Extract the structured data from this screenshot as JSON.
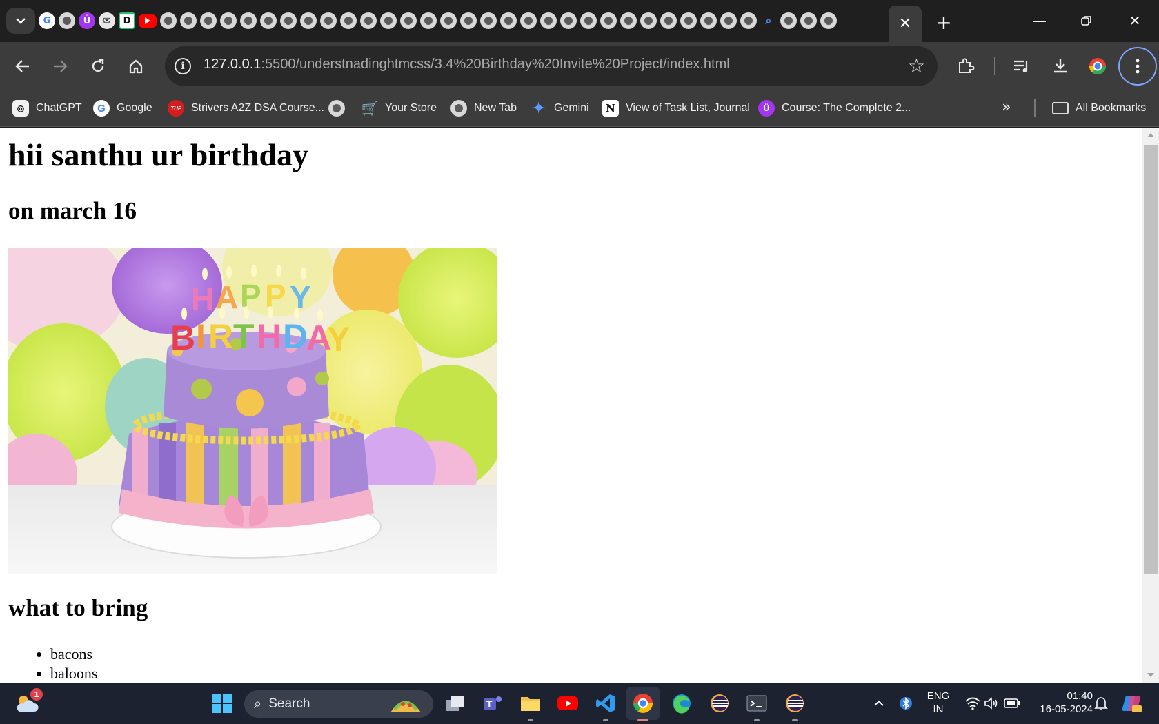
{
  "browser": {
    "url_host": "127.0.0.1",
    "url_path": ":5500/understnadinghtmcss/3.4%20Birthday%20Invite%20Project/index.html",
    "tabs": {
      "favicons": [
        "google",
        "globe",
        "udemy",
        "mail",
        "d-icon",
        "youtube",
        "globe",
        "globe",
        "globe",
        "globe",
        "globe",
        "globe",
        "globe",
        "globe",
        "globe",
        "globe",
        "globe",
        "globe",
        "globe",
        "globe",
        "globe",
        "globe",
        "globe",
        "globe",
        "globe",
        "globe",
        "globe",
        "globe",
        "globe",
        "globe",
        "globe",
        "globe",
        "globe",
        "globe",
        "globe",
        "globe",
        "lens",
        "globe",
        "globe",
        "globe"
      ]
    }
  },
  "bookmarks": [
    {
      "icon": "chatgpt-icon",
      "label": "ChatGPT"
    },
    {
      "icon": "google-icon",
      "label": "Google"
    },
    {
      "icon": "tuf-icon",
      "label": "Strivers A2Z DSA Course..."
    },
    {
      "icon": "globe-icon",
      "label": ""
    },
    {
      "icon": "cart-icon",
      "label": "Your Store"
    },
    {
      "icon": "globe-icon",
      "label": "New Tab"
    },
    {
      "icon": "gemini-icon",
      "label": "Gemini"
    },
    {
      "icon": "notion-icon",
      "label": "View of Task List, Journal"
    },
    {
      "icon": "udemy-icon",
      "label": "Course: The Complete 2..."
    }
  ],
  "bookmarks_all": "All Bookmarks",
  "page": {
    "heading": "hii santhu ur birthday",
    "date": "on march 16",
    "image_alt": "HAPPY BIRTHDAY",
    "bring_heading": "what to bring",
    "bring_items": [
      "bacons",
      "baloons"
    ]
  },
  "taskbar": {
    "search_placeholder": "Search",
    "weather_badge": "1",
    "lang_line1": "ENG",
    "lang_line2": "IN",
    "time": "01:40",
    "date": "16-05-2024"
  }
}
